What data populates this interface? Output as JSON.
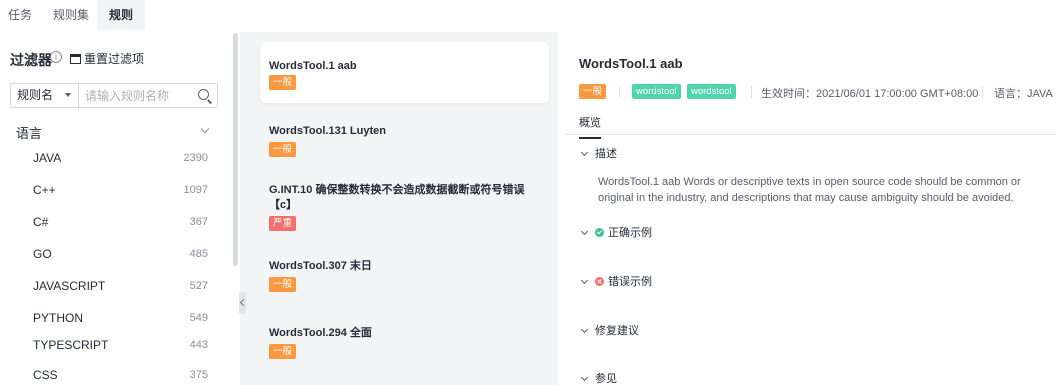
{
  "tabs": [
    {
      "label": "任务"
    },
    {
      "label": "规则集"
    },
    {
      "label": "规则"
    }
  ],
  "sidebar": {
    "filter_title": "过滤器",
    "info_glyph": "i",
    "reset_label": "重置过滤项",
    "search": {
      "field_label": "规则名",
      "placeholder": "请输入规则名称"
    },
    "facet_title": "语言",
    "languages": [
      {
        "name": "JAVA",
        "count": "2390"
      },
      {
        "name": "C++",
        "count": "1097"
      },
      {
        "name": "C#",
        "count": "367"
      },
      {
        "name": "GO",
        "count": "485"
      },
      {
        "name": "JAVASCRIPT",
        "count": "527"
      },
      {
        "name": "PYTHON",
        "count": "549"
      },
      {
        "name": "TYPESCRIPT",
        "count": "443"
      },
      {
        "name": "CSS",
        "count": "375"
      }
    ]
  },
  "rules": [
    {
      "title": "WordsTool.1 aab",
      "severity": "一般"
    },
    {
      "title": "WordsTool.131 Luyten",
      "severity": "一般"
    },
    {
      "title": "G.INT.10 确保整数转换不会造成数据截断或符号错误",
      "title_line2": "【c】",
      "severity": "严重"
    },
    {
      "title": "WordsTool.307 末日",
      "severity": "一般"
    },
    {
      "title": "WordsTool.294 全面",
      "severity": "一般"
    }
  ],
  "detail": {
    "title": "WordsTool.1 aab",
    "severity": "一般",
    "tags": [
      "wordstool",
      "wordstool"
    ],
    "effective_time": "生效时间：2021/06/01 17:00:00 GMT+08:00",
    "language": "语言：JAVA",
    "overview_tab": "概览",
    "sections": {
      "description": "描述",
      "correct_example": "正确示例",
      "error_example": "错误示例",
      "fix_suggestion": "修复建议",
      "references": "参见"
    },
    "description_text": "WordsTool.1 aab Words or descriptive texts in open source code should be common or original in the industry, and descriptions that may cause ambiguity should be avoided."
  },
  "colors": {
    "severity_normal": "#fa9841",
    "severity_serious": "#f66f6a",
    "tag_green": "#50d4ab",
    "list_background": "#f3f4f6"
  }
}
